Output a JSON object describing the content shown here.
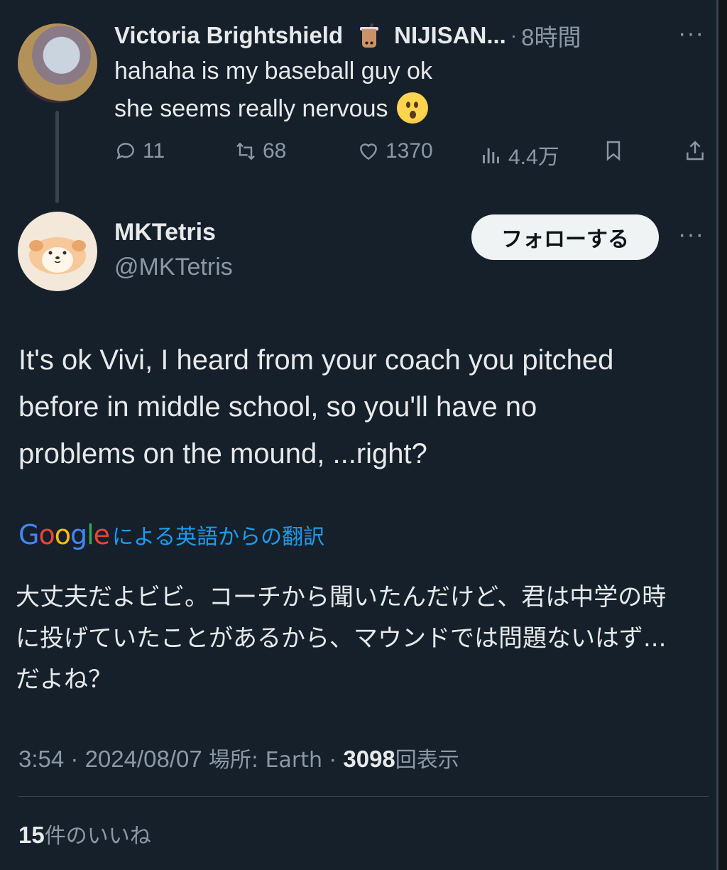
{
  "parent_tweet": {
    "author_name": "Victoria Brightshield",
    "team_badge": "NIJISAN...",
    "separator": "·",
    "time": "8時間",
    "more": "···",
    "line1": "hahaha is my baseball guy ok",
    "line2": "she seems really nervous",
    "emoji": "hushed-face-emoji",
    "actions": {
      "replies": "11",
      "retweets": "68",
      "likes": "1370",
      "views": "4.4万"
    }
  },
  "main_tweet": {
    "author_name": "MKTetris",
    "handle": "@MKTetris",
    "follow_label": "フォローする",
    "more": "···",
    "text_lines": [
      "It's ok Vivi, I heard from your coach you pitched",
      "before in middle school, so you'll have no",
      "problems on the mound, ...right?"
    ],
    "translation": {
      "provider_letters": [
        "G",
        "o",
        "o",
        "g",
        "l",
        "e"
      ],
      "label": "による英語からの翻訳",
      "lines": [
        "大丈夫だよビビ。コーチから聞いたんだけど、君は中学の時",
        "に投げていたことがあるから、マウンドでは問題ないはず...",
        "だよね？"
      ]
    },
    "meta": {
      "time": "3:54",
      "sep1": "·",
      "date": "2024/08/07",
      "location_label": "場所: Earth",
      "sep2": "·",
      "views_count": "3098",
      "views_label": "回表示"
    },
    "likes": {
      "count": "15",
      "label": "件のいいね"
    }
  },
  "colors": {
    "background": "#15202b",
    "text": "#e7e9ea",
    "muted": "#8b98a5",
    "link": "#1d9bf0",
    "follow_bg": "#eff3f4"
  }
}
